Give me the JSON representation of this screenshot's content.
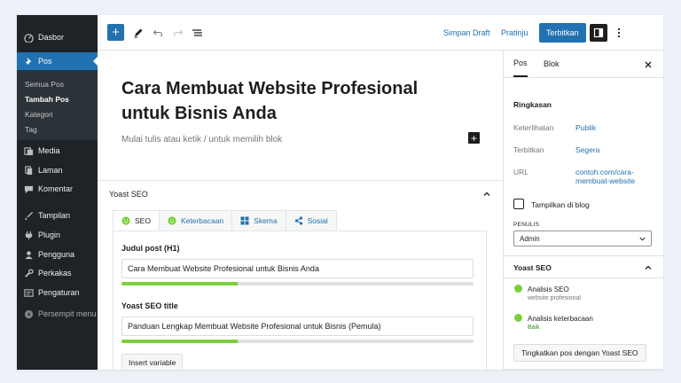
{
  "colors": {
    "accent": "#2271b1",
    "admin_bg": "#1d2327",
    "good": "#7ad03a"
  },
  "admin_menu": {
    "dashboard": "Dasbor",
    "posts": "Pos",
    "posts_sub": [
      "Semua Pos",
      "Tambah Pos",
      "Kategori",
      "Tag"
    ],
    "media": "Media",
    "pages": "Laman",
    "comments": "Komentar",
    "appearance": "Tampilan",
    "plugins": "Plugin",
    "users": "Pengguna",
    "tools": "Perkakas",
    "settings": "Pengaturan",
    "collapse": "Persempit menu"
  },
  "toolbar": {
    "save_draft": "Simpan Draft",
    "preview": "Pratinju",
    "publish": "Terbitkan",
    "icons": [
      "plus-icon",
      "pencil-icon",
      "undo-icon",
      "redo-icon",
      "list-view-icon",
      "sidebar-icon",
      "more-vertical-icon"
    ]
  },
  "editor": {
    "title_line1": "Cara Membuat Website Profesional",
    "title_line2": "untuk Bisnis Anda",
    "placeholder": "Mulai tulis atau ketik / untuk memilih blok"
  },
  "yoast_meta": {
    "title": "Yoast SEO",
    "tabs": [
      {
        "label": "SEO",
        "icon": "smiley-icon"
      },
      {
        "label": "Keterbacaan",
        "icon": "smiley-icon"
      },
      {
        "label": "Skema",
        "icon": "grid-icon"
      },
      {
        "label": "Sosial",
        "icon": "share-icon"
      }
    ],
    "post_title_label": "Judul post (H1)",
    "post_title_value": "Cara Membuat Website Profesional untuk Bisnis Anda",
    "post_title_progress": 0.33,
    "seo_title_label": "Yoast SEO title",
    "seo_title_value": "Panduan Lengkap Membuat Website Profesional untuk Bisnis (Pemula)",
    "seo_title_progress": 0.33,
    "insert_variable": "Insert variable"
  },
  "settings_panel": {
    "tab_post": "Pos",
    "tab_block": "Blok",
    "summary": "Ringkasan",
    "visibility_label": "Keterlihatan",
    "visibility_value": "Publik",
    "publish_label": "Terbitkan",
    "publish_value": "Segera",
    "url_label": "URL",
    "url_value_line1": "contoh.com/cara-",
    "url_value_line2": "membuat-website",
    "show_in_blog": "Tampilkan di blog",
    "author_label": "PENULIS",
    "author_value": "Admin",
    "yoast_title": "Yoast SEO",
    "seo_analysis_title": "Analisis SEO",
    "seo_analysis_sub": "website profesional",
    "readability_title": "Analisis keterbacaan",
    "readability_sub": "Baik",
    "improve_button": "Tingkatkan pos dengan Yoast SEO"
  }
}
